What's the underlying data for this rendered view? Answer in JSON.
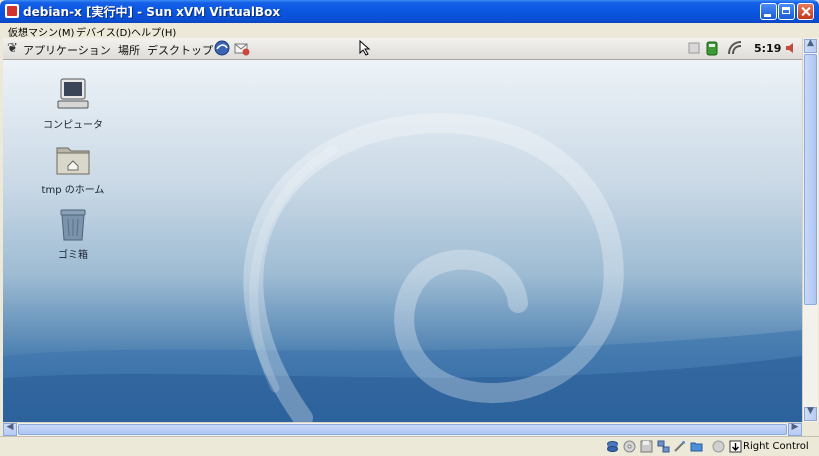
{
  "window": {
    "title": "debian-x [実行中] - Sun xVM VirtualBox"
  },
  "vbox_menu": [
    {
      "label": "仮想マシン(M)"
    },
    {
      "label": "デバイス(D)"
    },
    {
      "label": "ヘルプ(H)"
    }
  ],
  "gnome_panel": {
    "menus": [
      {
        "label": "アプリケーション"
      },
      {
        "label": "場所"
      },
      {
        "label": "デスクトップ"
      }
    ],
    "clock": "5:19"
  },
  "desktop_icons": [
    {
      "label": "コンピュータ",
      "icon": "computer-icon"
    },
    {
      "label": "tmp のホーム",
      "icon": "home-folder-icon"
    },
    {
      "label": "ゴミ箱",
      "icon": "trash-icon"
    }
  ],
  "statusbar": {
    "host_key": "Right Control"
  },
  "colors": {
    "titlebar": "#0a56e0",
    "close_button": "#c2391c",
    "wallpaper_dark": "#285f99",
    "panel": "#e9e8e4"
  }
}
